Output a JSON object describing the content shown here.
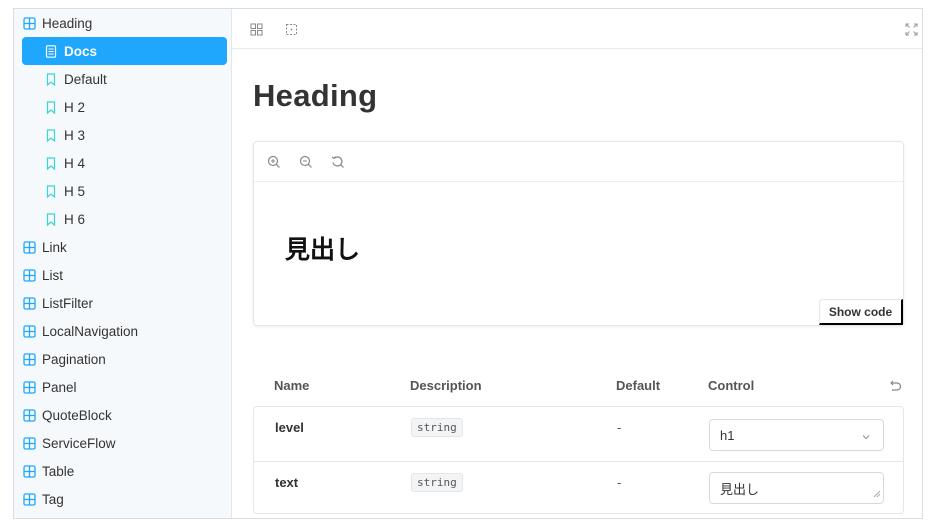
{
  "sidebar": {
    "items": [
      {
        "label": "Heading",
        "icon": "component-icon",
        "level": 0
      },
      {
        "label": "Docs",
        "icon": "document-icon",
        "level": 1,
        "active": true
      },
      {
        "label": "Default",
        "icon": "bookmark-icon",
        "level": 1
      },
      {
        "label": "H 2",
        "icon": "bookmark-icon",
        "level": 1
      },
      {
        "label": "H 3",
        "icon": "bookmark-icon",
        "level": 1
      },
      {
        "label": "H 4",
        "icon": "bookmark-icon",
        "level": 1
      },
      {
        "label": "H 5",
        "icon": "bookmark-icon",
        "level": 1
      },
      {
        "label": "H 6",
        "icon": "bookmark-icon",
        "level": 1
      },
      {
        "label": "Link",
        "icon": "component-icon",
        "level": 0
      },
      {
        "label": "List",
        "icon": "component-icon",
        "level": 0
      },
      {
        "label": "ListFilter",
        "icon": "component-icon",
        "level": 0
      },
      {
        "label": "LocalNavigation",
        "icon": "component-icon",
        "level": 0
      },
      {
        "label": "Pagination",
        "icon": "component-icon",
        "level": 0
      },
      {
        "label": "Panel",
        "icon": "component-icon",
        "level": 0
      },
      {
        "label": "QuoteBlock",
        "icon": "component-icon",
        "level": 0
      },
      {
        "label": "ServiceFlow",
        "icon": "component-icon",
        "level": 0
      },
      {
        "label": "Table",
        "icon": "component-icon",
        "level": 0
      },
      {
        "label": "Tag",
        "icon": "component-icon",
        "level": 0
      }
    ]
  },
  "toolbar": {
    "icons": [
      "grid-icon",
      "outline-icon",
      "fullscreen-icon"
    ]
  },
  "page": {
    "title": "Heading"
  },
  "canvas": {
    "zoom_icons": [
      "zoom-in-icon",
      "zoom-out-icon",
      "zoom-reset-icon"
    ],
    "preview_text": "見出し",
    "show_code_label": "Show code"
  },
  "args_table": {
    "headers": {
      "name": "Name",
      "description": "Description",
      "default": "Default",
      "control": "Control"
    },
    "rows": [
      {
        "name": "level",
        "type": "string",
        "default": "-",
        "control_value": "h1",
        "control_kind": "select"
      },
      {
        "name": "text",
        "type": "string",
        "default": "-",
        "control_value": "見出し",
        "control_kind": "textarea"
      }
    ]
  },
  "colors": {
    "accent": "#1ea7fd",
    "component_icon": "#1ea7fd",
    "story_icon": "#37d5d3"
  }
}
